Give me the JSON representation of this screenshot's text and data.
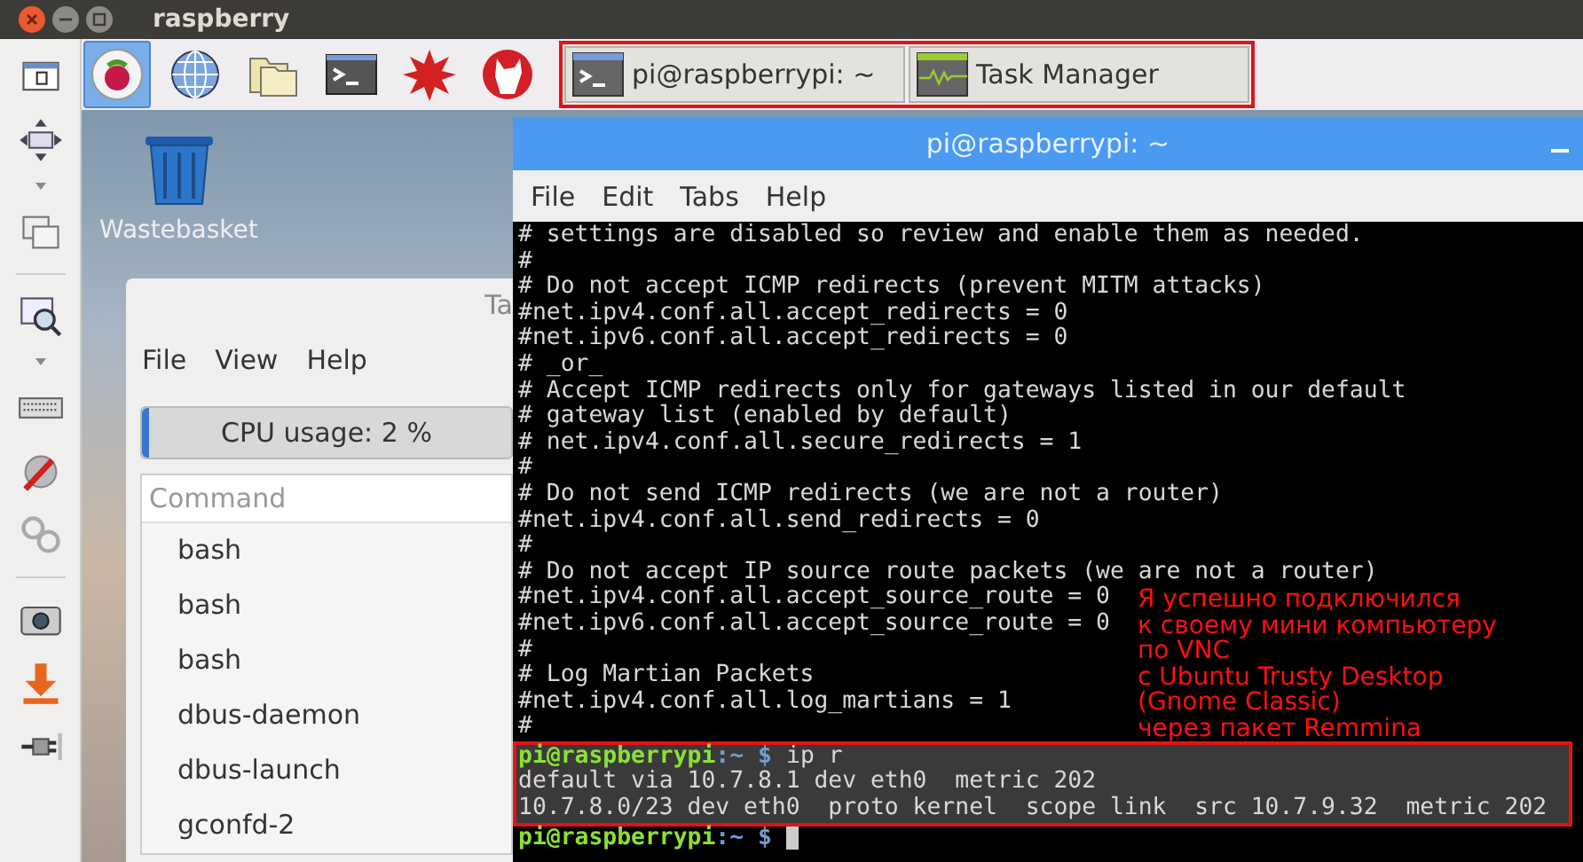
{
  "window": {
    "title": "raspberry"
  },
  "launchers": [
    {
      "kind": "raspberry",
      "selected": true
    },
    {
      "kind": "globe",
      "selected": false
    },
    {
      "kind": "folder",
      "selected": false
    },
    {
      "kind": "terminal",
      "selected": false
    },
    {
      "kind": "burst",
      "selected": false
    },
    {
      "kind": "wolf",
      "selected": false
    }
  ],
  "taskbar": {
    "highlight": true,
    "windows": [
      {
        "kind": "terminal",
        "label": "pi@raspberrypi: ~"
      },
      {
        "kind": "monitor",
        "label": "Task Manager"
      }
    ]
  },
  "desktop_icons": [
    {
      "label": "Wastebasket"
    }
  ],
  "task_manager": {
    "title": "Ta",
    "menu": [
      "File",
      "View",
      "Help"
    ],
    "cpu": {
      "label": "CPU usage: 2 %",
      "level": 0.02
    },
    "column": "Command",
    "processes": [
      "bash",
      "bash",
      "bash",
      "dbus-daemon",
      "dbus-launch",
      "gconfd-2"
    ]
  },
  "terminal": {
    "title": "pi@raspberrypi: ~",
    "menu": [
      "File",
      "Edit",
      "Tabs",
      "Help"
    ],
    "lines": [
      "# settings are disabled so review and enable them as needed.",
      "#",
      "# Do not accept ICMP redirects (prevent MITM attacks)",
      "#net.ipv4.conf.all.accept_redirects = 0",
      "#net.ipv6.conf.all.accept_redirects = 0",
      "# _or_",
      "# Accept ICMP redirects only for gateways listed in our default",
      "# gateway list (enabled by default)",
      "# net.ipv4.conf.all.secure_redirects = 1",
      "#",
      "# Do not send ICMP redirects (we are not a router)",
      "#net.ipv4.conf.all.send_redirects = 0",
      "#",
      "# Do not accept IP source route packets (we are not a router)",
      "#net.ipv4.conf.all.accept_source_route = 0",
      "#net.ipv6.conf.all.accept_source_route = 0",
      "#",
      "# Log Martian Packets",
      "#net.ipv4.conf.all.log_martians = 1",
      "#"
    ],
    "session": {
      "highlight": true,
      "lines": [
        {
          "kind": "prompt",
          "user_host": "pi@raspberrypi",
          "path": ":~",
          "symbol": "$",
          "command": "ip r"
        },
        {
          "kind": "output",
          "text": "default via 10.7.8.1 dev eth0  metric 202"
        },
        {
          "kind": "output",
          "text": "10.7.8.0/23 dev eth0  proto kernel  scope link  src 10.7.9.32  metric 202"
        }
      ]
    },
    "last_prompt": {
      "user_host": "pi@raspberrypi",
      "path": ":~",
      "symbol": "$"
    }
  },
  "annotation": [
    "Я успешно подключился",
    "к своему мини компьютеру",
    "по VNC",
    "с Ubuntu Trusty Desktop",
    "(Gnome Classic)",
    "через пакет Remmina"
  ]
}
